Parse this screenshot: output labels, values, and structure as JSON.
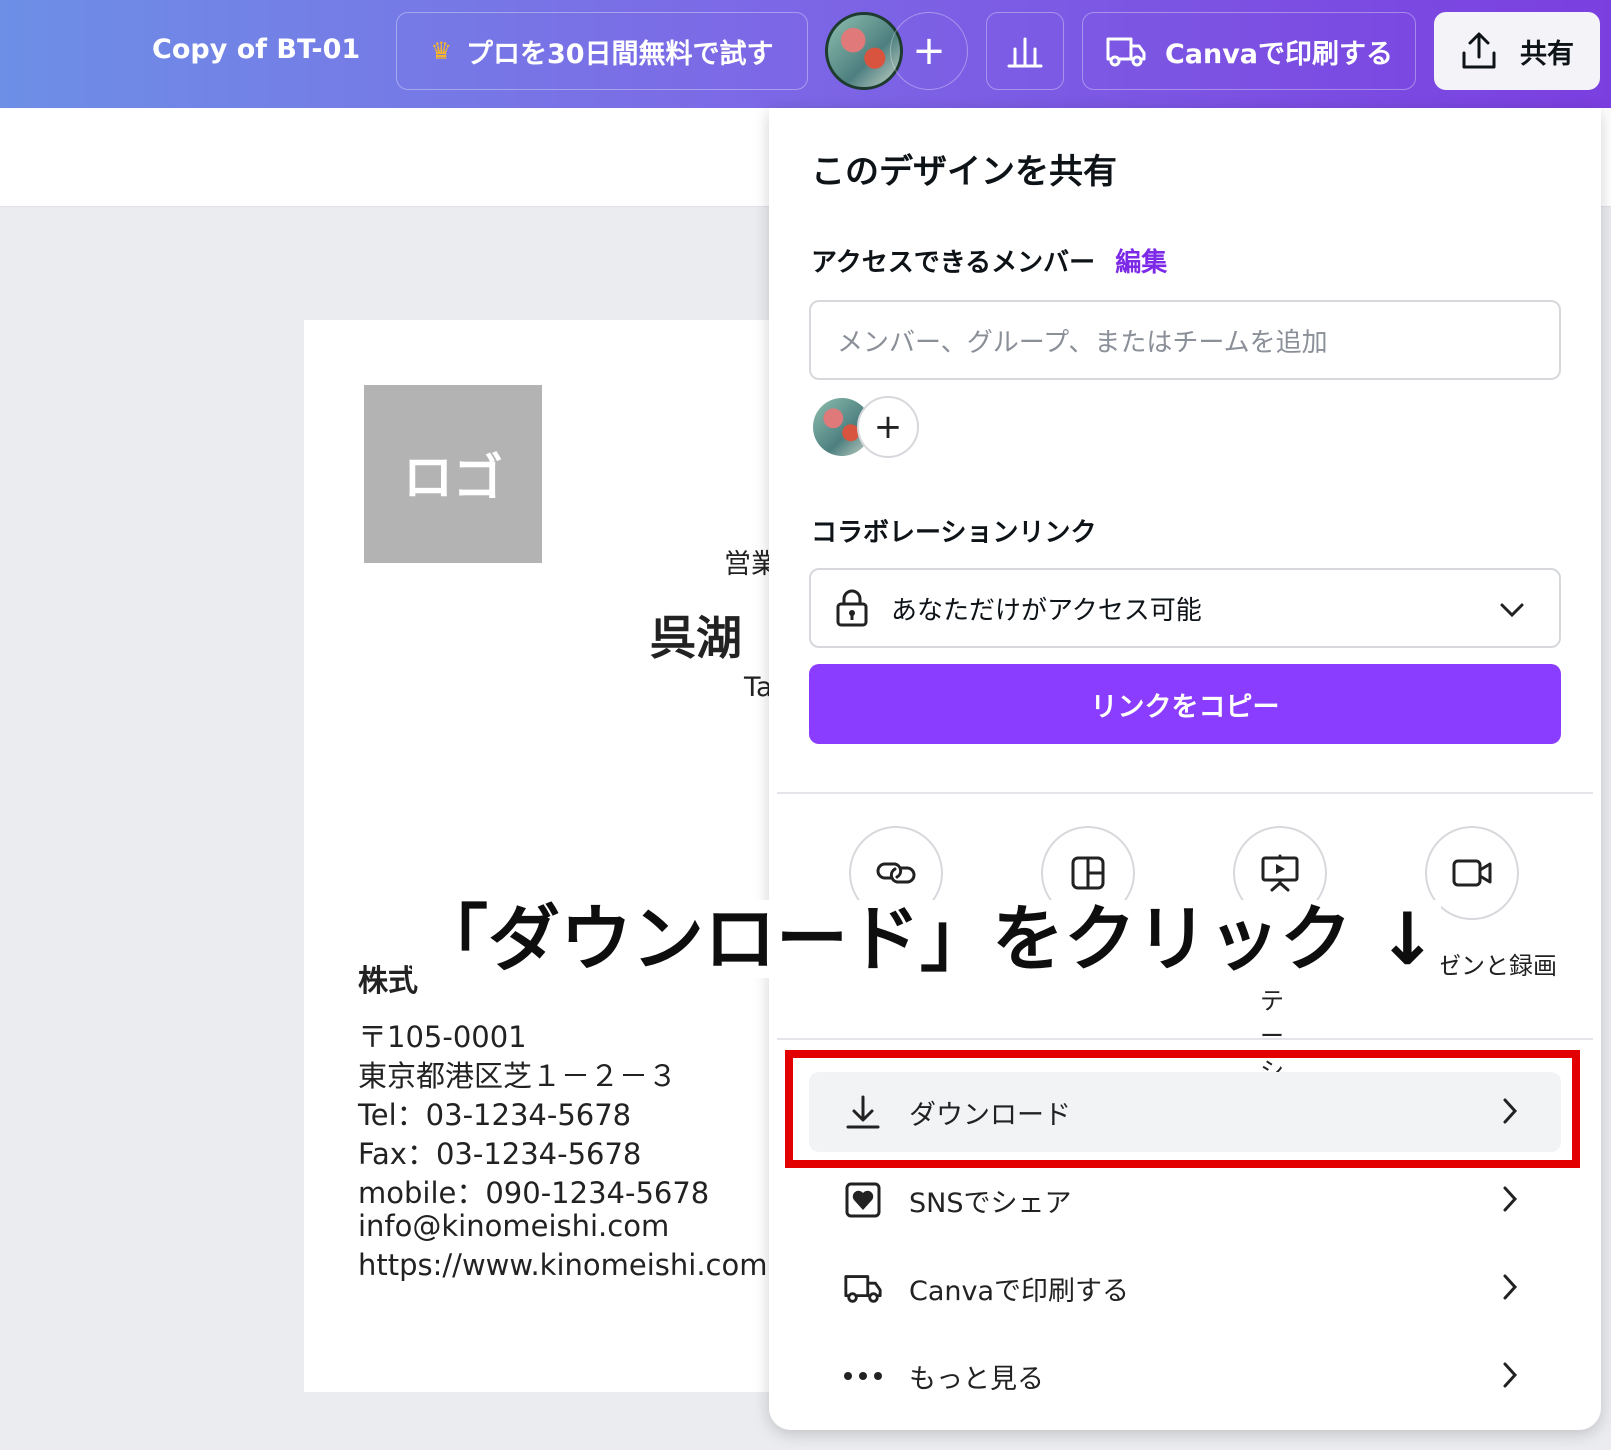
{
  "topbar": {
    "title": "Copy of BT-01",
    "pro_label": "プロを30日間無料で試す",
    "print_label": "Canvaで印刷する",
    "share_label": "共有"
  },
  "card": {
    "logo_text": "ロゴ",
    "role_partial": "営業",
    "name_partial": "呉湖",
    "roman_partial": "Ta",
    "company_partial": "株式",
    "postal": "〒105-0001",
    "address": "東京都港区芝１－２－３",
    "tel": "Tel：03-1234-5678",
    "fax": "Fax：03-1234-5678",
    "mobile": "mobile：090-1234-5678",
    "email": "info@kinomeishi.com",
    "url": "https://www.kinomeishi.com"
  },
  "share_panel": {
    "title": "このデザインを共有",
    "members_label": "アクセスできるメンバー",
    "edit_label": "編集",
    "member_input_placeholder": "メンバー、グループ、またはチームを追加",
    "collab_label": "コラボレーションリンク",
    "access_value": "あなただけがアクセス可能",
    "copy_link_label": "リンクをコピー",
    "options": [
      {
        "icon": "link-icon",
        "label": ""
      },
      {
        "icon": "template-icon",
        "label": ""
      },
      {
        "icon": "present-icon",
        "label": "ンテーション"
      },
      {
        "icon": "video-camera-icon",
        "label": "プレゼンと録画"
      }
    ],
    "list": [
      {
        "icon": "download-icon",
        "label": "ダウンロード"
      },
      {
        "icon": "heart-icon",
        "label": "SNSでシェア"
      },
      {
        "icon": "truck-icon",
        "label": "Canvaで印刷する"
      },
      {
        "icon": "more-icon",
        "label": "もっと見る"
      }
    ]
  },
  "annotation": {
    "text": "「ダウンロード」をクリック ↓"
  },
  "colors": {
    "accent": "#8b3dff",
    "highlight": "#e30000",
    "link": "#7d2ae8"
  }
}
